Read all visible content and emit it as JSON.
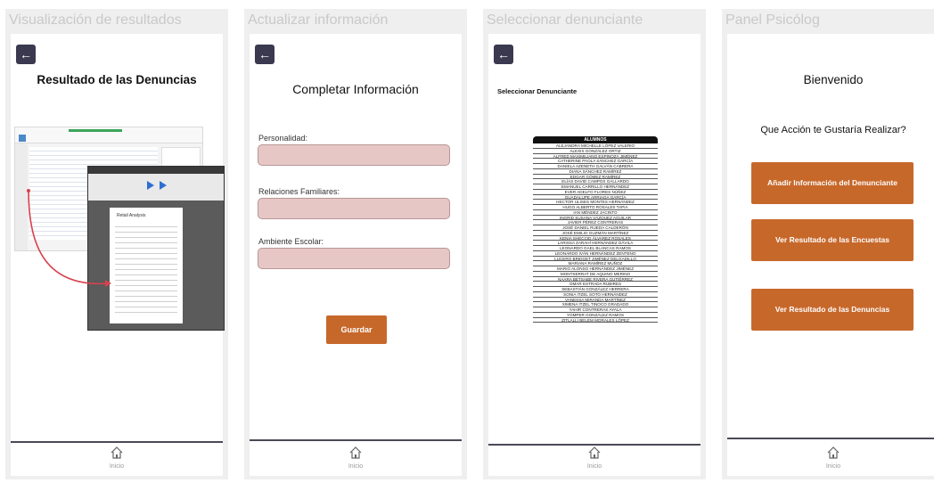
{
  "frames": [
    {
      "title": "Visualización de resultados",
      "heading": "Resultado de las Denuncias",
      "report_heading": "Retail Analysis"
    },
    {
      "title": "Actualizar información",
      "heading": "Completar Información",
      "fields": [
        {
          "label": "Personalidad:"
        },
        {
          "label": "Relaciones Familiares:"
        },
        {
          "label": "Ambiente Escolar:"
        }
      ],
      "save_label": "Guardar"
    },
    {
      "title": "Seleccionar denunciante",
      "heading": "Seleccionar Denunciante",
      "table_header": "ALUMNOS",
      "students": [
        "ALEJANDRA MICHELLE LÓPEZ VALERIO",
        "ALEXIS GONZÁLEZ ORTIZ",
        "ALFRED MAXIMILIANO ESPINOZA JIMÉNEZ",
        "CATHERINE PAOLA SÁNCHEZ GARCÍA",
        "DANIELA AZENETH GALVÁN CABRERA",
        "DIANA SÁNCHEZ RAMÍREZ",
        "EDGAR GÓMEZ RAMÍREZ",
        "ELÍAS DAVID CAMPOS GALLARDO",
        "EMANUEL CARRILLO HERNÁNDEZ",
        "EVER ADELFO FLORES NÚÑEZ",
        "GUADALUPE ARRIAGA GARCÍA",
        "HECTOR ULISES MONTES HERNÁNDEZ",
        "HUGO ALBERTO ROSALES TAPIA",
        "IAN MÉNDEZ JACINTO",
        "INGRID SUSANA VÁZQUEZ AGUILAR",
        "JAVIER PÉREZ CONTRERAS",
        "JOSÉ DANIEL RUEDA CALDERÓN",
        "JOSÉ EMILIO GUZMÁN MARTÍNEZ",
        "KENIA SHECCID ÁLVAREZ ROSALES",
        "LARISSA ZARAHÍ HERNÁNDEZ DÁVILA",
        "LEONARDO GAEL BLANCAS RAMOS",
        "LEONARDO IVÁN HERNÁNDEZ ZENTENO",
        "LUCERO BRIDGET JIMÉNEZ DELGADILLO",
        "MARIANA RAMÍREZ MUÑOZ",
        "MARIO ALONSO HERNÁNDEZ JIMÉNEZ",
        "MONTSERRAT DE AQUINO MERINO",
        "NAARA BETSABE RIVERA GUTIÉRREZ",
        "OMAR ESTRADA RUBIRES",
        "SEBASTIÁN GONZÁLEZ HERRERA",
        "SONIA ITZEL SOTO HERNÁNDEZ",
        "VANESSA MIRANDA MARTÍNEZ",
        "XIMENA ITZEL TINOCO GRADADO",
        "YAHIR CONTRERAS AYALA",
        "YOMPER GONZÁLEZ RAMOS",
        "ZITLALLI BELEM MORALES LÓPEZ"
      ]
    },
    {
      "title": "Panel Psicólog",
      "welcome": "Bienvenido",
      "question": "Que Acción te Gustaría Realizar?",
      "actions": [
        {
          "label": "Añadir Información del Denunciante"
        },
        {
          "label": "Ver Resultado de las Encuestas"
        },
        {
          "label": "Ver Resultado de las Denuncias"
        }
      ]
    }
  ],
  "nav": {
    "label": "Inicio",
    "icon": "home-icon"
  },
  "colors": {
    "accent": "#c7682b",
    "back_button": "#3a3950",
    "input_fill": "#e7c6c6"
  }
}
